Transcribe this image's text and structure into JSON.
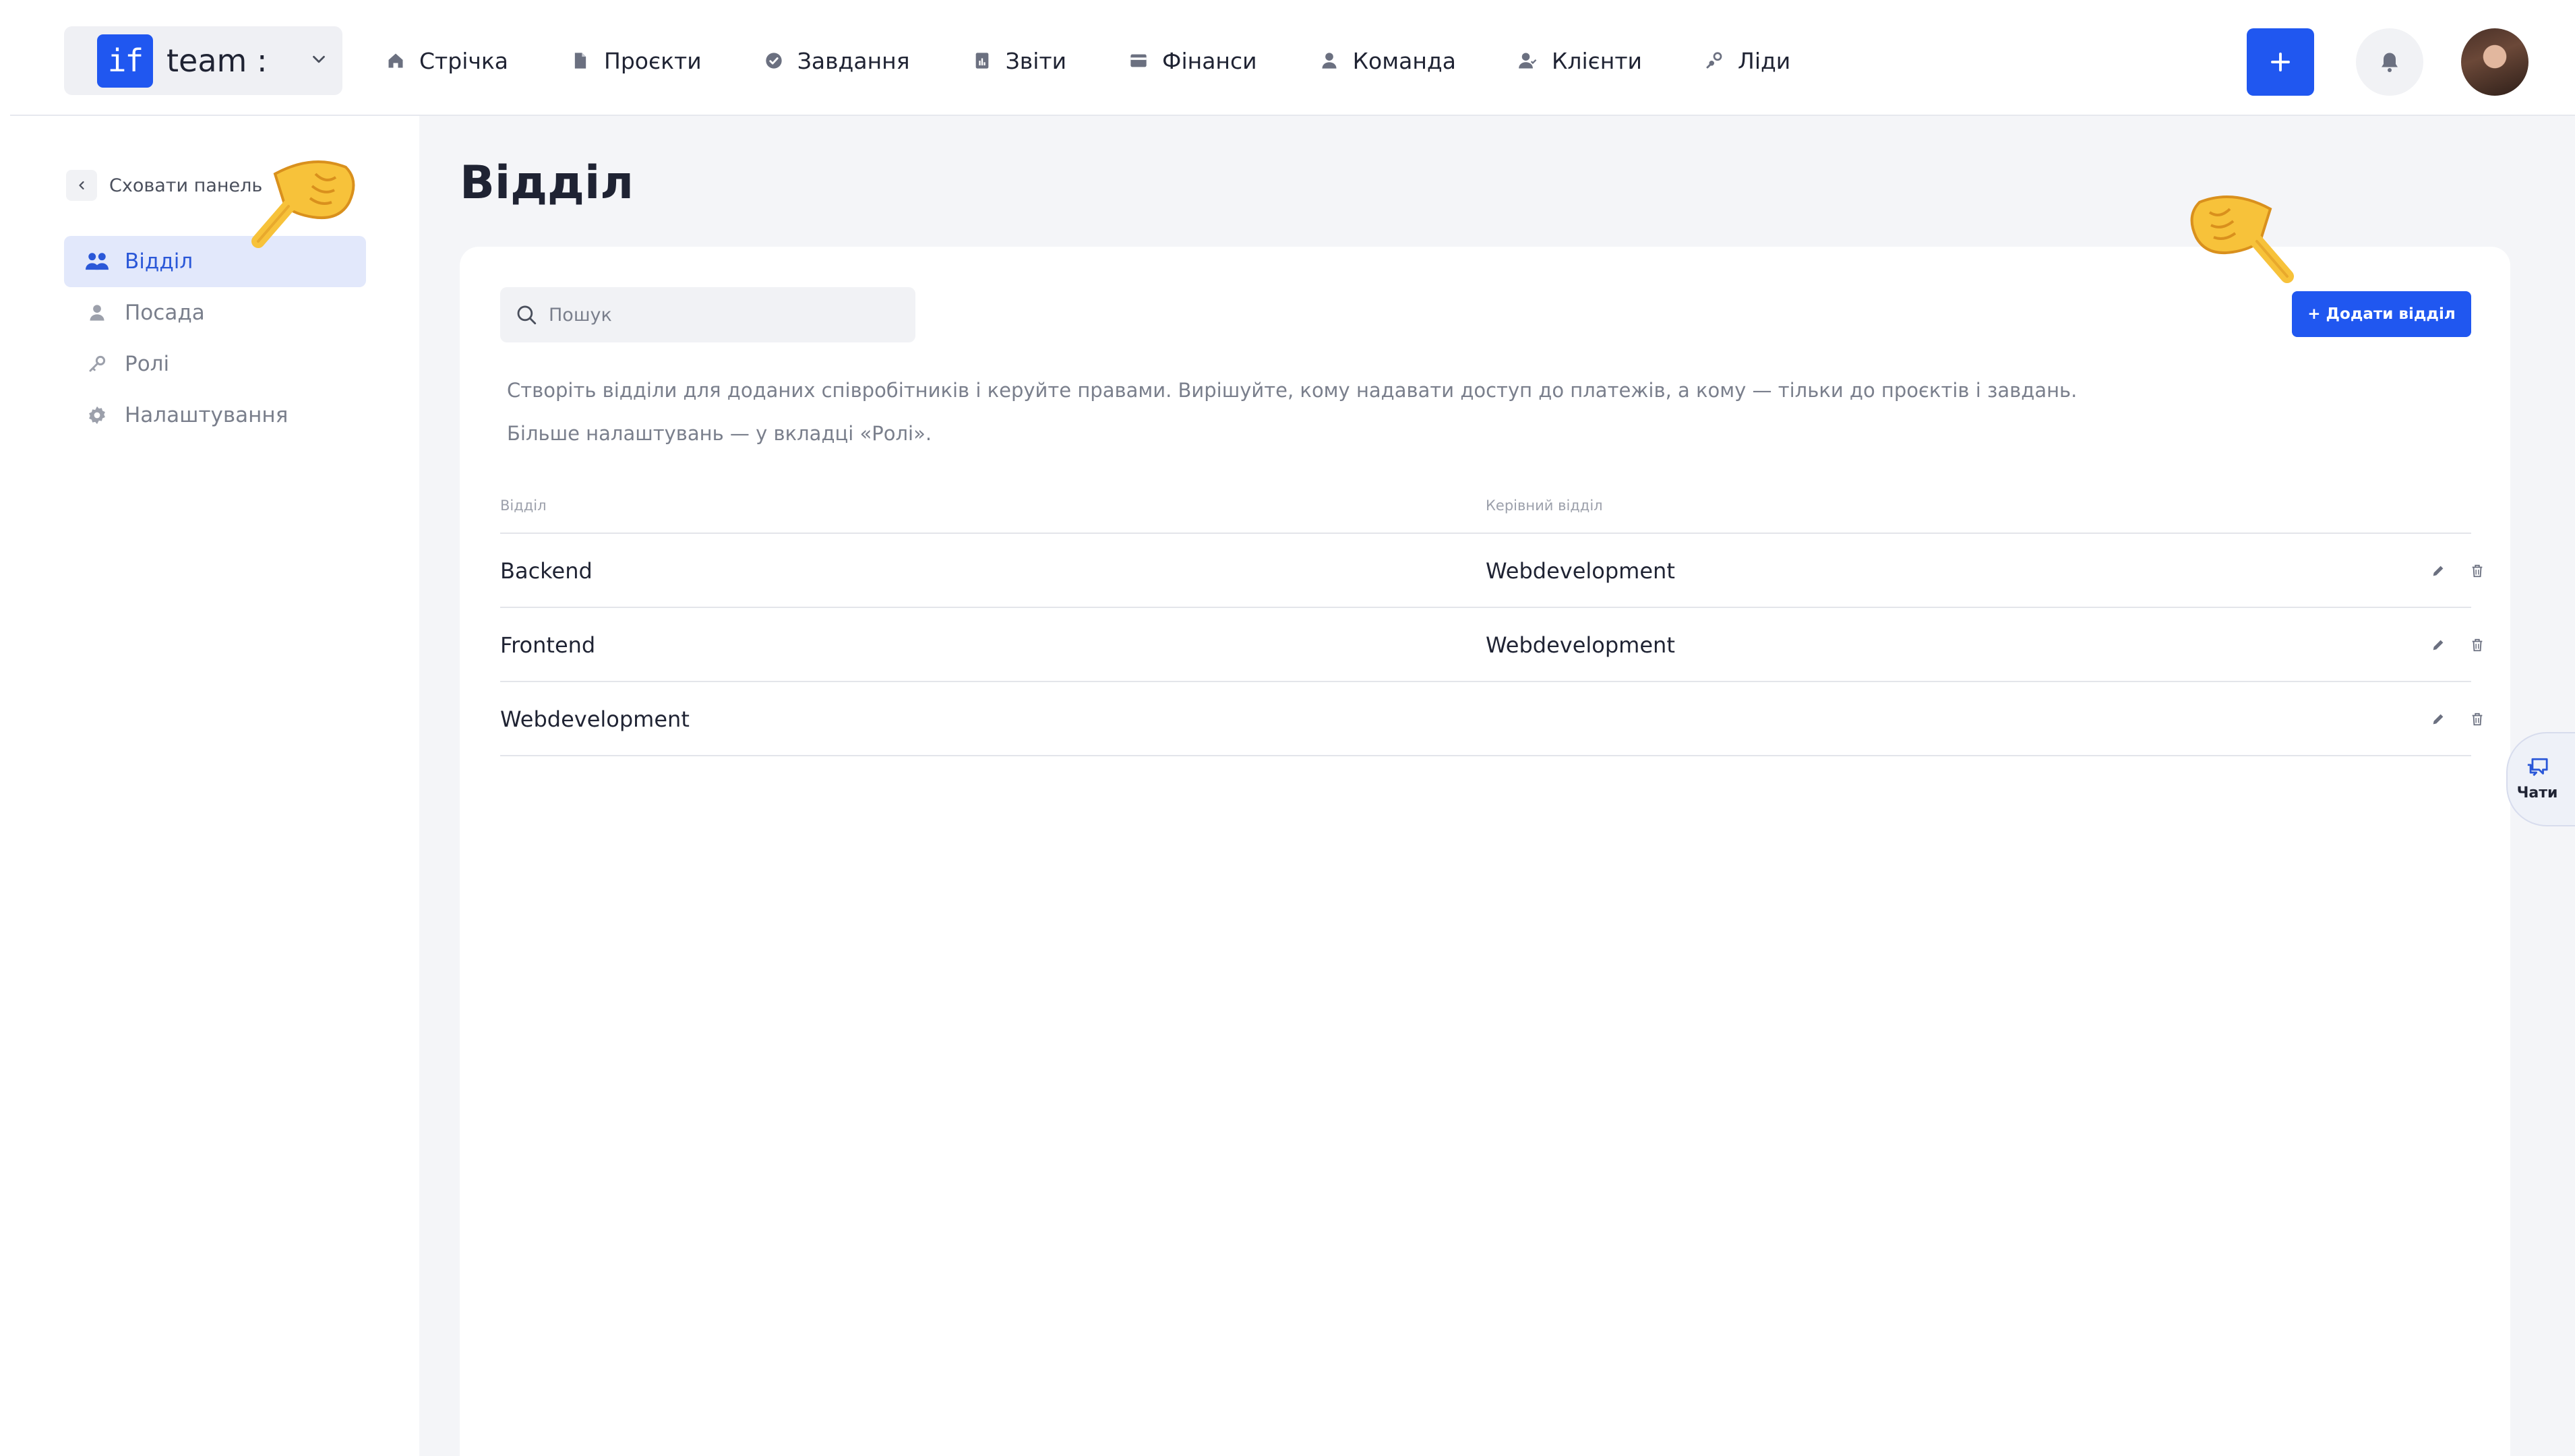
{
  "brand": {
    "logo_text": "if",
    "name": "team :"
  },
  "nav": [
    {
      "label": "Стрічка",
      "icon": "home-icon"
    },
    {
      "label": "Проєкти",
      "icon": "file-icon"
    },
    {
      "label": "Завдання",
      "icon": "check-circle-icon"
    },
    {
      "label": "Звіти",
      "icon": "report-icon"
    },
    {
      "label": "Фінанси",
      "icon": "wallet-icon"
    },
    {
      "label": "Команда",
      "icon": "user-icon"
    },
    {
      "label": "Клієнти",
      "icon": "clients-icon"
    },
    {
      "label": "Ліди",
      "icon": "leads-icon"
    }
  ],
  "sidebar": {
    "collapse_label": "Сховати панель",
    "items": [
      {
        "label": "Відділ",
        "icon": "team-icon",
        "active": true
      },
      {
        "label": "Посада",
        "icon": "user-icon",
        "active": false
      },
      {
        "label": "Ролі",
        "icon": "key-icon",
        "active": false
      },
      {
        "label": "Налаштування",
        "icon": "gear-icon",
        "active": false
      }
    ]
  },
  "main": {
    "title": "Відділ",
    "search_placeholder": "Пошук",
    "add_button": "+ Додати відділ",
    "description_1": "Створіть відділи для доданих співробітників і керуйте правами. Вирішуйте, кому надавати доступ до платежів, а кому — тільки до проєктів і завдань.",
    "description_2": "Більше налаштувань — у вкладці «Ролі».",
    "table": {
      "columns": [
        "Відділ",
        "Керівний відділ"
      ],
      "rows": [
        {
          "name": "Backend",
          "parent": "Webdevelopment"
        },
        {
          "name": "Frontend",
          "parent": "Webdevelopment"
        },
        {
          "name": "Webdevelopment",
          "parent": ""
        }
      ]
    }
  },
  "chats_label": "Чати",
  "colors": {
    "accent": "#2057f0",
    "active_bg": "#e2e8fb",
    "main_bg": "#f4f5f8"
  }
}
